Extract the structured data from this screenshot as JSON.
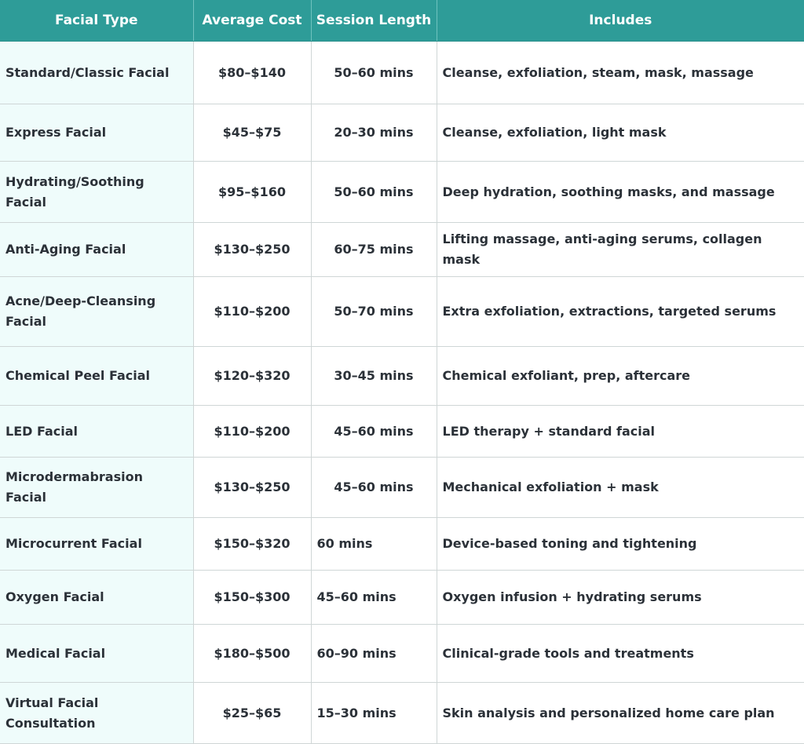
{
  "headers": [
    "Facial Type",
    "Average Cost",
    "Session Length",
    "Includes"
  ],
  "rows": [
    {
      "type": "Standard/Classic Facial",
      "cost": "$80–$140",
      "length": "50–60 mins",
      "includes": "Cleanse, exfoliation, steam, mask, massage"
    },
    {
      "type": "Express Facial",
      "cost": "$45–$75",
      "length": "20–30 mins",
      "includes": "Cleanse, exfoliation, light mask"
    },
    {
      "type": "Hydrating/Soothing Facial",
      "cost": "$95–$160",
      "length": "50–60 mins",
      "includes": "Deep hydration, soothing masks, and massage"
    },
    {
      "type": "Anti-Aging Facial",
      "cost": "$130–$250",
      "length": "60–75 mins",
      "includes": "Lifting massage, anti-aging serums, collagen mask"
    },
    {
      "type": "Acne/Deep-Cleansing Facial",
      "cost": "$110–$200",
      "length": "50–70 mins",
      "includes": "Extra exfoliation, extractions, targeted serums"
    },
    {
      "type": "Chemical Peel Facial",
      "cost": "$120–$320",
      "length": "30–45 mins",
      "includes": "Chemical exfoliant, prep, aftercare"
    },
    {
      "type": "LED Facial",
      "cost": "$110–$200",
      "length": "45–60 mins",
      "includes": "LED therapy + standard facial"
    },
    {
      "type": "Microdermabrasion Facial",
      "cost": "$130–$250",
      "length": "45–60 mins",
      "includes": "Mechanical exfoliation + mask"
    },
    {
      "type": "Microcurrent Facial",
      "cost": "$150–$320",
      "length": "60 mins",
      "includes": "Device-based toning and tightening"
    },
    {
      "type": "Oxygen Facial",
      "cost": "$150–$300",
      "length": "45–60 mins",
      "includes": "Oxygen infusion + hydrating serums"
    },
    {
      "type": "Medical Facial",
      "cost": "$180–$500",
      "length": "60–90 mins",
      "includes": "Clinical-grade tools and treatments"
    },
    {
      "type": "Virtual Facial Consultation",
      "cost": "$25–$65",
      "length": "15–30 mins",
      "includes": "Skin analysis and personalized home care plan"
    }
  ],
  "colors": {
    "header_bg": "#2e9c98",
    "first_col_bg": "#effcfb"
  }
}
